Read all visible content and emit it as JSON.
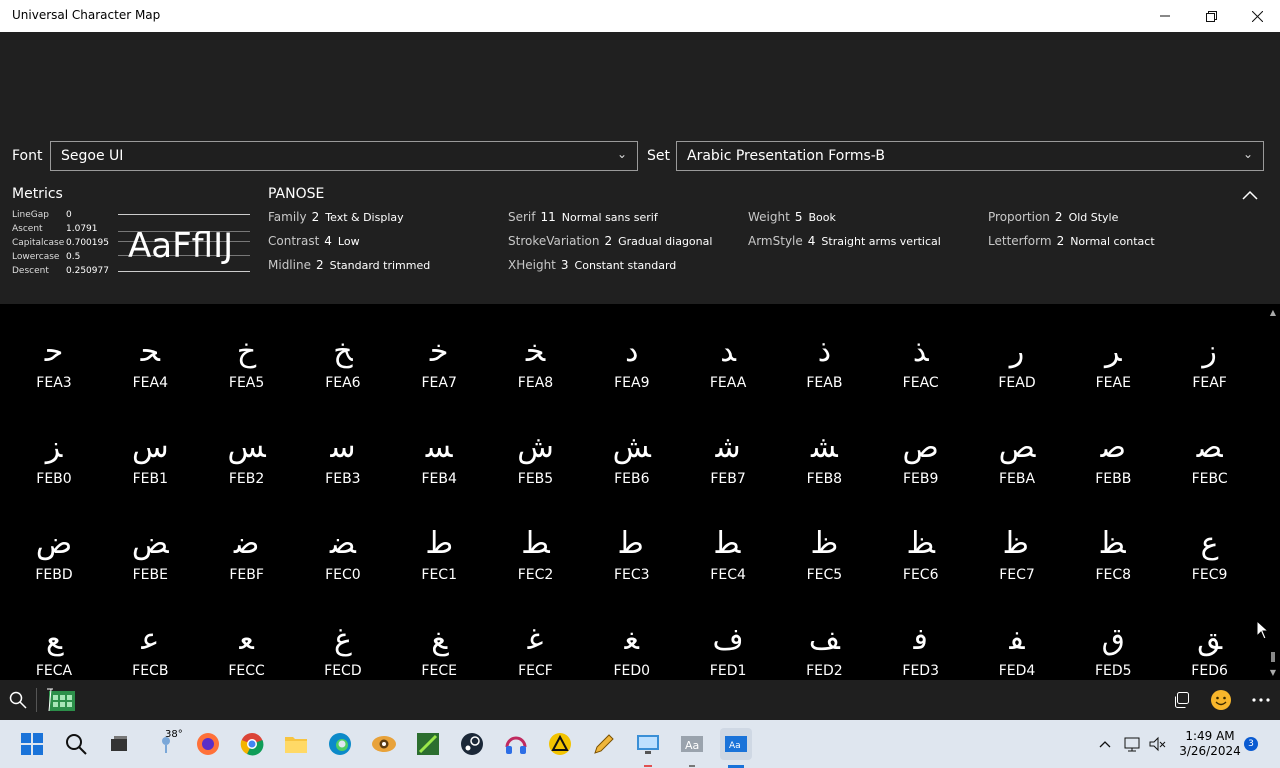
{
  "window": {
    "title": "Universal Character Map"
  },
  "font_picker": {
    "label": "Font",
    "value": "Segoe UI"
  },
  "set_picker": {
    "label": "Set",
    "value": "Arabic Presentation Forms-B"
  },
  "metrics": {
    "title": "Metrics",
    "rows": [
      {
        "name": "LineGap",
        "value": "0"
      },
      {
        "name": "Ascent",
        "value": "1.0791"
      },
      {
        "name": "Capitalcase",
        "value": "0.700195"
      },
      {
        "name": "Lowercase",
        "value": "0.5"
      },
      {
        "name": "Descent",
        "value": "0.250977"
      }
    ],
    "preview_text": "AaFflIJ"
  },
  "panose": {
    "title": "PANOSE",
    "items": [
      {
        "name": "Family",
        "num": "2",
        "desc": "Text & Display"
      },
      {
        "name": "Contrast",
        "num": "4",
        "desc": "Low"
      },
      {
        "name": "Midline",
        "num": "2",
        "desc": "Standard trimmed"
      },
      {
        "name": "Serif",
        "num": "11",
        "desc": "Normal sans serif"
      },
      {
        "name": "StrokeVariation",
        "num": "2",
        "desc": "Gradual diagonal"
      },
      {
        "name": "XHeight",
        "num": "3",
        "desc": "Constant standard"
      },
      {
        "name": "Weight",
        "num": "5",
        "desc": "Book"
      },
      {
        "name": "ArmStyle",
        "num": "4",
        "desc": "Straight arms vertical"
      },
      {
        "name": "Proportion",
        "num": "2",
        "desc": "Old Style"
      },
      {
        "name": "Letterform",
        "num": "2",
        "desc": "Normal contact"
      }
    ]
  },
  "characters": [
    {
      "glyph": "ﺣ",
      "code": "FEA3"
    },
    {
      "glyph": "ﺤ",
      "code": "FEA4"
    },
    {
      "glyph": "ﺥ",
      "code": "FEA5"
    },
    {
      "glyph": "ﺦ",
      "code": "FEA6"
    },
    {
      "glyph": "ﺧ",
      "code": "FEA7"
    },
    {
      "glyph": "ﺨ",
      "code": "FEA8"
    },
    {
      "glyph": "ﺩ",
      "code": "FEA9"
    },
    {
      "glyph": "ﺪ",
      "code": "FEAA"
    },
    {
      "glyph": "ﺫ",
      "code": "FEAB"
    },
    {
      "glyph": "ﺬ",
      "code": "FEAC"
    },
    {
      "glyph": "ﺭ",
      "code": "FEAD"
    },
    {
      "glyph": "ﺮ",
      "code": "FEAE"
    },
    {
      "glyph": "ﺯ",
      "code": "FEAF"
    },
    {
      "glyph": "ﺰ",
      "code": "FEB0"
    },
    {
      "glyph": "ﺱ",
      "code": "FEB1"
    },
    {
      "glyph": "ﺲ",
      "code": "FEB2"
    },
    {
      "glyph": "ﺳ",
      "code": "FEB3"
    },
    {
      "glyph": "ﺴ",
      "code": "FEB4"
    },
    {
      "glyph": "ﺵ",
      "code": "FEB5"
    },
    {
      "glyph": "ﺶ",
      "code": "FEB6"
    },
    {
      "glyph": "ﺷ",
      "code": "FEB7"
    },
    {
      "glyph": "ﺸ",
      "code": "FEB8"
    },
    {
      "glyph": "ﺹ",
      "code": "FEB9"
    },
    {
      "glyph": "ﺺ",
      "code": "FEBA"
    },
    {
      "glyph": "ﺻ",
      "code": "FEBB"
    },
    {
      "glyph": "ﺼ",
      "code": "FEBC"
    },
    {
      "glyph": "ﺽ",
      "code": "FEBD"
    },
    {
      "glyph": "ﺾ",
      "code": "FEBE"
    },
    {
      "glyph": "ﺿ",
      "code": "FEBF"
    },
    {
      "glyph": "ﻀ",
      "code": "FEC0"
    },
    {
      "glyph": "ﻁ",
      "code": "FEC1"
    },
    {
      "glyph": "ﻂ",
      "code": "FEC2"
    },
    {
      "glyph": "ﻃ",
      "code": "FEC3"
    },
    {
      "glyph": "ﻄ",
      "code": "FEC4"
    },
    {
      "glyph": "ﻅ",
      "code": "FEC5"
    },
    {
      "glyph": "ﻆ",
      "code": "FEC6"
    },
    {
      "glyph": "ﻇ",
      "code": "FEC7"
    },
    {
      "glyph": "ﻈ",
      "code": "FEC8"
    },
    {
      "glyph": "ﻉ",
      "code": "FEC9"
    },
    {
      "glyph": "ﻊ",
      "code": "FECA"
    },
    {
      "glyph": "ﻋ",
      "code": "FECB"
    },
    {
      "glyph": "ﻌ",
      "code": "FECC"
    },
    {
      "glyph": "ﻍ",
      "code": "FECD"
    },
    {
      "glyph": "ﻎ",
      "code": "FECE"
    },
    {
      "glyph": "ﻏ",
      "code": "FECF"
    },
    {
      "glyph": "ﻐ",
      "code": "FED0"
    },
    {
      "glyph": "ﻑ",
      "code": "FED1"
    },
    {
      "glyph": "ﻒ",
      "code": "FED2"
    },
    {
      "glyph": "ﻓ",
      "code": "FED3"
    },
    {
      "glyph": "ﻔ",
      "code": "FED4"
    },
    {
      "glyph": "ﻕ",
      "code": "FED5"
    },
    {
      "glyph": "ﻖ",
      "code": "FED6"
    }
  ],
  "taskbar": {
    "weather_temp": "38°",
    "time": "1:49 AM",
    "date": "3/26/2024",
    "notification_count": "3"
  }
}
